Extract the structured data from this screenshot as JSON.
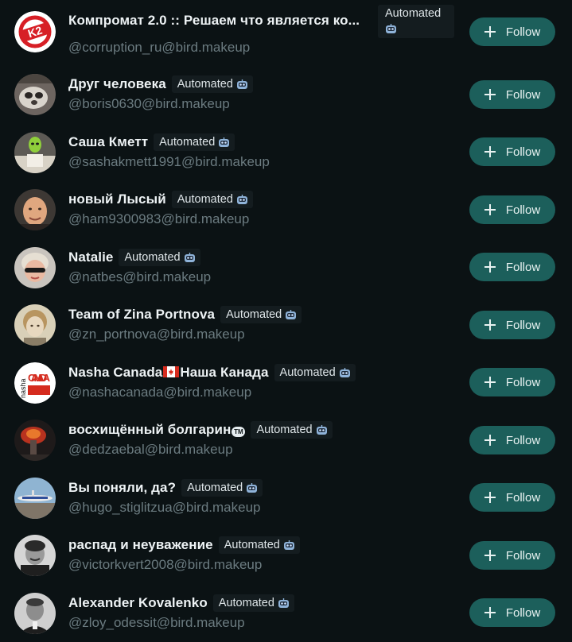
{
  "follow_label": "Follow",
  "automated_label": "Automated",
  "accounts": [
    {
      "name": "Компромат 2.0 :: Решаем что является ко...",
      "handle": "@corruption_ru@bird.makeup",
      "avatar_text": "K2"
    },
    {
      "name": "Друг человека",
      "handle": "@boris0630@bird.makeup"
    },
    {
      "name": "Саша Кметт",
      "handle": "@sashakmett1991@bird.makeup"
    },
    {
      "name": "новый Лысый",
      "handle": "@ham9300983@bird.makeup"
    },
    {
      "name": "Natalie",
      "handle": "@natbes@bird.makeup"
    },
    {
      "name": "Team of Zina Portnova",
      "handle": "@zn_portnova@bird.makeup"
    },
    {
      "name_before": "Nasha Canada",
      "name_after": "Наша Канада",
      "handle": "@nashacanada@bird.makeup",
      "avatar_text_top": "nasha",
      "avatar_text_main": "CANADA"
    },
    {
      "name": "восхищённый болгарин",
      "tm_text": "TM",
      "handle": "@dedzaebal@bird.makeup"
    },
    {
      "name": "Вы поняли, да?",
      "handle": "@hugo_stiglitzua@bird.makeup"
    },
    {
      "name": "распад и неуважение",
      "handle": "@victorkvert2008@bird.makeup"
    },
    {
      "name": "Alexander Kovalenko",
      "handle": "@zloy_odessit@bird.makeup"
    }
  ],
  "colors": {
    "background": "#0b1214",
    "follow_button": "#1c5f5b",
    "badge_bg": "#141c1f",
    "handle_text": "#6b7b80"
  }
}
